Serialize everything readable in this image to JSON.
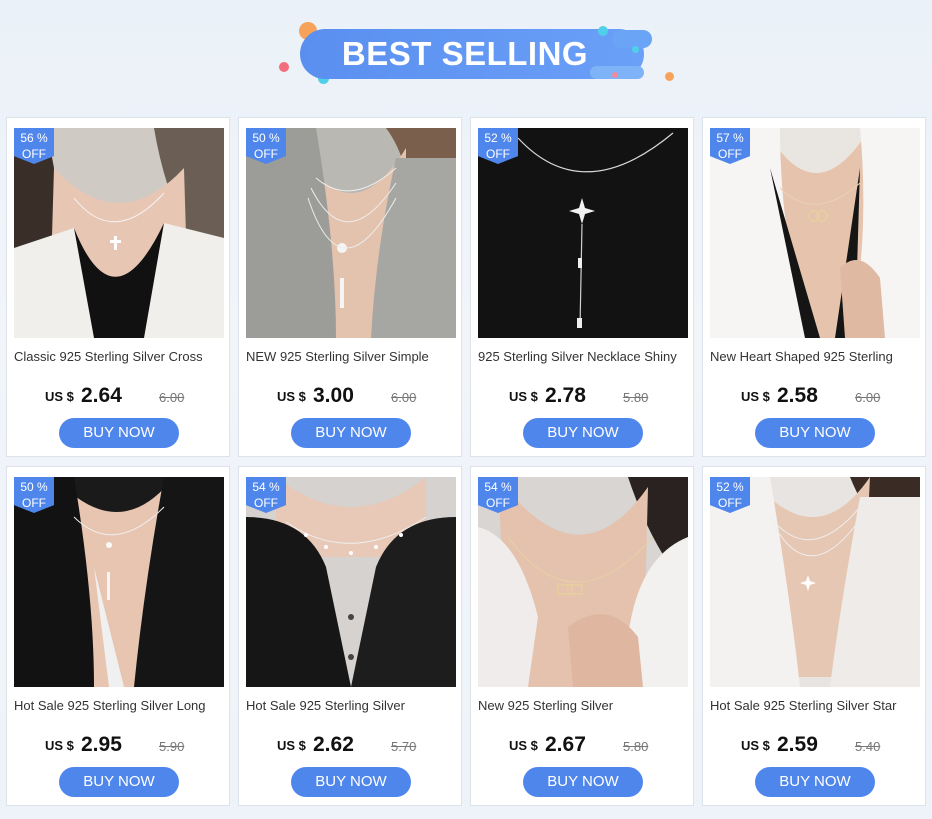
{
  "banner": {
    "title": "BEST SELLING"
  },
  "colors": {
    "accent": "#4f86ec",
    "banner": "#5a8ff0"
  },
  "products": [
    {
      "name": "Classic 925 Sterling Silver Cross",
      "discount": "56 %",
      "off": "OFF",
      "currency": "US $",
      "price": "2.64",
      "old_price": "6.00",
      "button": "BUY NOW",
      "scene": "light-cross"
    },
    {
      "name": "NEW 925 Sterling Silver Simple",
      "discount": "50 %",
      "off": "OFF",
      "currency": "US $",
      "price": "3.00",
      "old_price": "6.00",
      "button": "BUY NOW",
      "scene": "grey-shirt-layers"
    },
    {
      "name": "925 Sterling Silver Necklace Shiny",
      "discount": "52 %",
      "off": "OFF",
      "currency": "US $",
      "price": "2.78",
      "old_price": "5.80",
      "button": "BUY NOW",
      "scene": "black-star-drop"
    },
    {
      "name": "New Heart Shaped 925 Sterling",
      "discount": "57 %",
      "off": "OFF",
      "currency": "US $",
      "price": "2.58",
      "old_price": "6.00",
      "button": "BUY NOW",
      "scene": "white-blazer-hearts"
    },
    {
      "name": "Hot Sale 925 Sterling Silver Long",
      "discount": "50 %",
      "off": "OFF",
      "currency": "US $",
      "price": "2.95",
      "old_price": "5.90",
      "button": "BUY NOW",
      "scene": "black-jacket-bar"
    },
    {
      "name": "Hot Sale 925 Sterling Silver",
      "discount": "54 %",
      "off": "OFF",
      "currency": "US $",
      "price": "2.62",
      "old_price": "5.70",
      "button": "BUY NOW",
      "scene": "black-shirt-sequin"
    },
    {
      "name": "New 925 Sterling Silver",
      "discount": "54 %",
      "off": "OFF",
      "currency": "US $",
      "price": "2.67",
      "old_price": "5.80",
      "button": "BUY NOW",
      "scene": "white-shirt-links"
    },
    {
      "name": "Hot Sale 925 Sterling Silver Star",
      "discount": "52 %",
      "off": "OFF",
      "currency": "US $",
      "price": "2.59",
      "old_price": "5.40",
      "button": "BUY NOW",
      "scene": "white-satin-star"
    }
  ]
}
